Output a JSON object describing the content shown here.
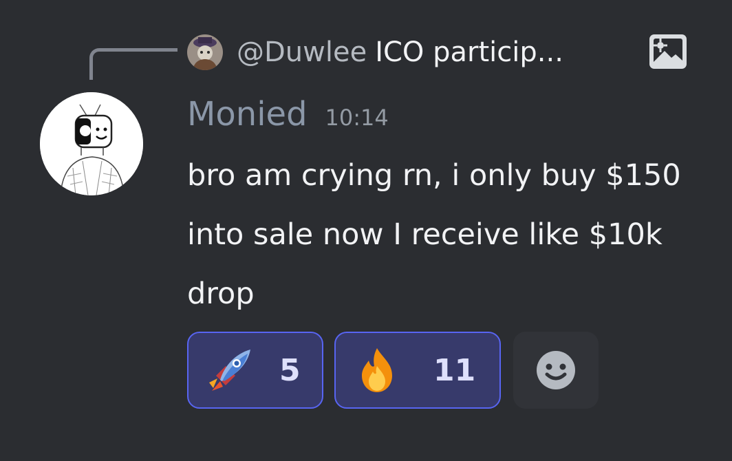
{
  "reply": {
    "author": "@Duwlee",
    "text": "ICO particip...",
    "attachment_icon": "image-icon"
  },
  "message": {
    "username": "Monied",
    "timestamp": "10:14",
    "text": "bro am crying rn, i only buy $150 into sale now I receive like $10k drop"
  },
  "reactions": [
    {
      "emoji": "rocket",
      "count": "5",
      "selected": true
    },
    {
      "emoji": "fire",
      "count": "11",
      "selected": true
    }
  ],
  "add_reaction_icon": "smiley-icon",
  "colors": {
    "background": "#2b2d31",
    "username": "#8b97a8",
    "reaction_border": "#5865f2",
    "reaction_fill": "#373a6b"
  }
}
